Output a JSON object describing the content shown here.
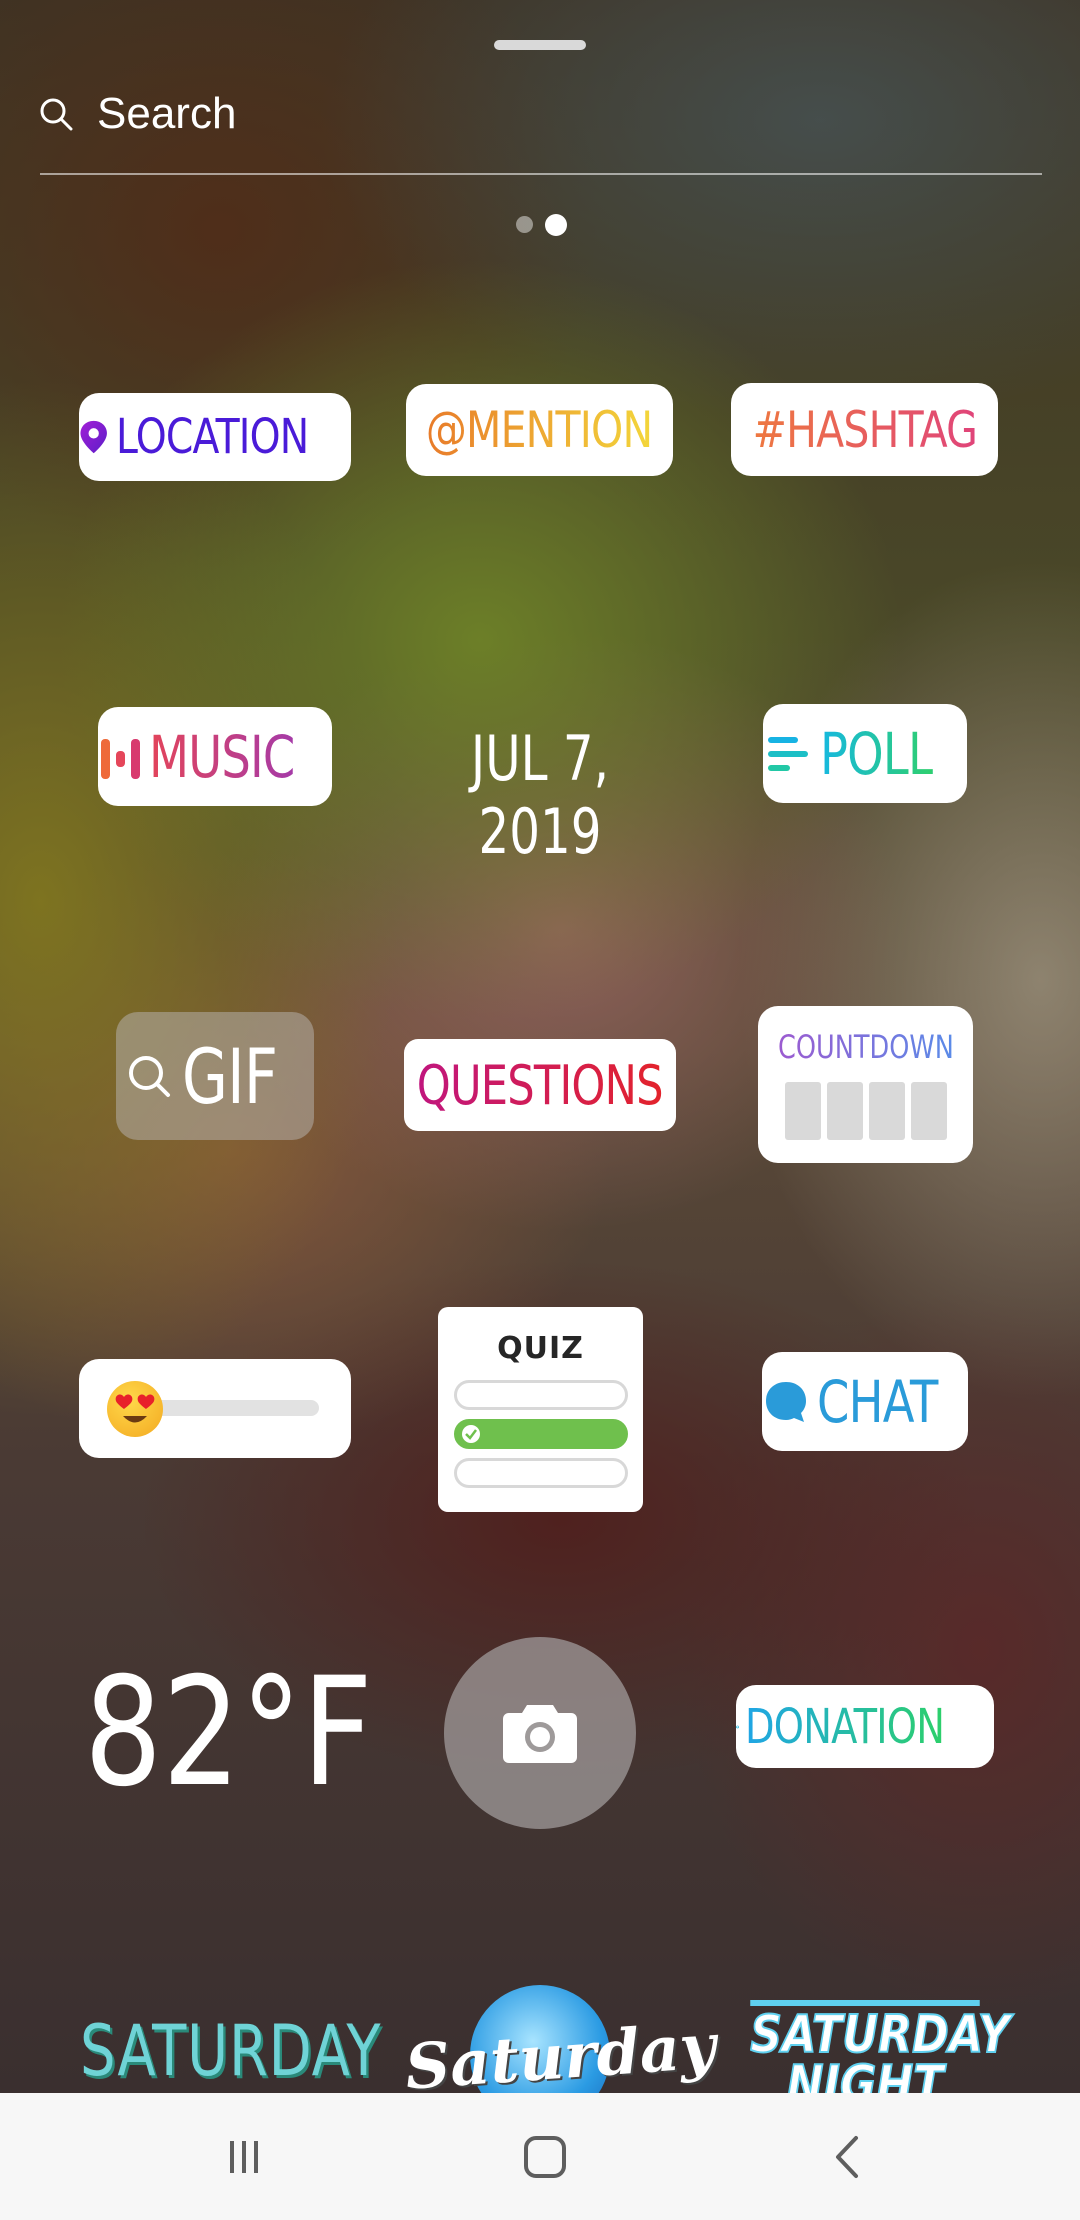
{
  "search": {
    "placeholder": "Search",
    "icon": "search-icon"
  },
  "pager": {
    "pages": 2,
    "active": 2
  },
  "stickers": {
    "location": {
      "label": "LOCATION",
      "icon": "map-pin-icon",
      "color": "#4a1bd8"
    },
    "mention": {
      "label": "@MENTION",
      "colors": [
        "#e87b2a",
        "#f3d63b"
      ]
    },
    "hashtag": {
      "label": "#HASHTAG",
      "colors": [
        "#ee7840",
        "#e0447a"
      ]
    },
    "music": {
      "label": "MUSIC",
      "icon": "music-bars-icon"
    },
    "date": {
      "label": "JUL 7, 2019"
    },
    "poll": {
      "label": "POLL",
      "icon": "poll-lines-icon"
    },
    "gif": {
      "label": "GIF",
      "icon": "search-icon"
    },
    "questions": {
      "label": "QUESTIONS"
    },
    "countdown": {
      "label": "COUNTDOWN"
    },
    "emoji_slider": {
      "emoji": "heart-eyes-emoji-icon"
    },
    "quiz": {
      "label": "QUIZ",
      "correct_option": 2
    },
    "chat": {
      "label": "CHAT",
      "icon": "chat-bubble-icon"
    },
    "temperature": {
      "label": "82°F"
    },
    "camera": {
      "icon": "camera-icon"
    },
    "donation": {
      "label": "DONATION",
      "icon": "heart-icon"
    },
    "saturday_1": {
      "label": "SATURDAY"
    },
    "saturday_2": {
      "label": "Saturday"
    },
    "saturday_3": {
      "label": "SATURDAY NIGHT"
    }
  },
  "navbar": {
    "recents": "recents-icon",
    "home": "home-icon",
    "back": "back-icon"
  }
}
